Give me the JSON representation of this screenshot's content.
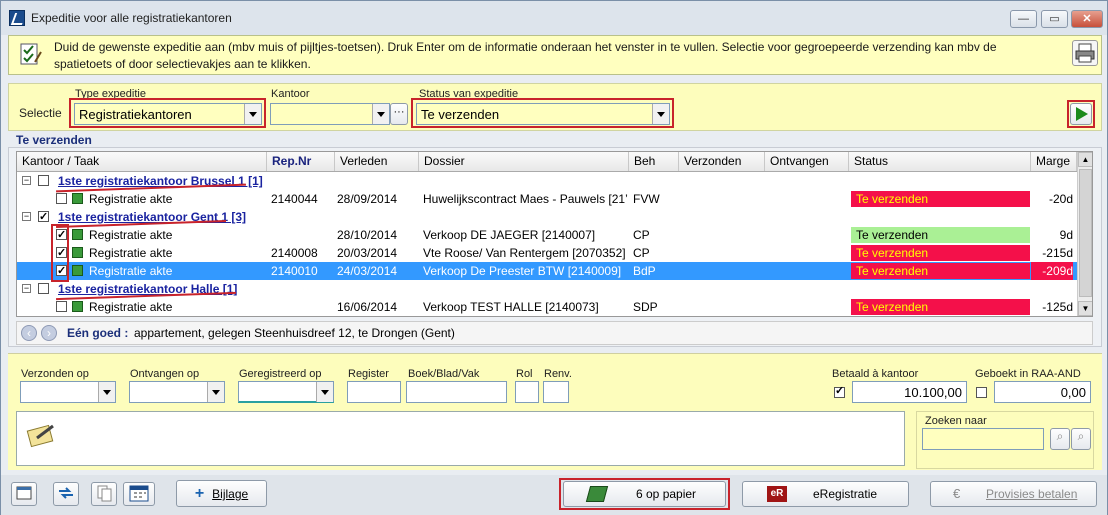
{
  "window": {
    "title": "Expeditie voor alle registratiekantoren"
  },
  "info": {
    "text": "Duid de gewenste expeditie aan (mbv muis of pijltjes-toetsen). Druk Enter om de informatie onderaan het venster in te vullen. Selectie voor gegroepeerde verzending kan mbv de spatietoets of door selectievakjes aan te klikken."
  },
  "selection": {
    "label": "Selectie",
    "type_label": "Type expeditie",
    "type_value": "Registratiekantoren",
    "office_label": "Kantoor",
    "office_value": "",
    "status_label": "Status van expeditie",
    "status_value": "Te verzenden"
  },
  "grid_section": {
    "title": "Te verzenden"
  },
  "columns": [
    "Kantoor / Taak",
    "Rep.Nr",
    "Verleden",
    "Dossier",
    "Beh",
    "Verzonden",
    "Ontvangen",
    "Status",
    "Marge"
  ],
  "rows": [
    {
      "kind": "group",
      "checked": false,
      "name": "1ste registratiekantoor Brussel 1 [1]"
    },
    {
      "kind": "task",
      "checked": false,
      "task": "Registratie akte",
      "rep": "2140044",
      "date": "28/09/2014",
      "dossier": "Huwelijkscontract Maes - Pauwels [21’",
      "beh": "FVW",
      "status": "Te verzenden",
      "status_color": "red",
      "marge": "-20d"
    },
    {
      "kind": "group",
      "checked": true,
      "name": "1ste registratiekantoor Gent 1 [3]"
    },
    {
      "kind": "task",
      "checked": true,
      "task": "Registratie akte",
      "rep": "",
      "date": "28/10/2014",
      "dossier": "Verkoop DE JAEGER [2140007]",
      "beh": "CP",
      "status": "Te verzenden",
      "status_color": "green",
      "marge": "9d"
    },
    {
      "kind": "task",
      "checked": true,
      "task": "Registratie akte",
      "rep": "2140008",
      "date": "20/03/2014",
      "dossier": "Vte Roose/ Van Rentergem [2070352]",
      "beh": "CP",
      "status": "Te verzenden",
      "status_color": "red",
      "marge": "-215d"
    },
    {
      "kind": "task",
      "checked": true,
      "selected": true,
      "task": "Registratie akte",
      "rep": "2140010",
      "date": "24/03/2014",
      "dossier": "Verkoop De Preester BTW [2140009]",
      "beh": "BdP",
      "status": "Te verzenden",
      "status_color": "red",
      "marge": "-209d"
    },
    {
      "kind": "group",
      "checked": false,
      "name": "1ste registratiekantoor Halle [1]"
    },
    {
      "kind": "task",
      "checked": false,
      "task": "Registratie akte",
      "rep": "",
      "date": "16/06/2014",
      "dossier": "Verkoop TEST HALLE [2140073]",
      "beh": "SDP",
      "status": "Te verzenden",
      "status_color": "red",
      "marge": "-125d"
    }
  ],
  "goods": {
    "label": "Eén goed :",
    "text": "appartement, gelegen Steenhuisdreef 12, te Drongen (Gent)"
  },
  "details": {
    "sent_on": "Verzonden op",
    "received_on": "Ontvangen op",
    "registered_on": "Geregistreerd op",
    "register": "Register",
    "book": "Boek/Blad/Vak",
    "rol": "Rol",
    "renv": "Renv.",
    "paid_label": "Betaald à kantoor",
    "paid_value": "10.100,00",
    "paid_checked": true,
    "booked_label": "Geboekt in RAA-AND",
    "booked_value": "0,00",
    "booked_checked": false,
    "search_label": "Zoeken naar",
    "search_value": ""
  },
  "footer": {
    "attachment": "Bijlage",
    "paper": "6 op papier",
    "ereg": "eRegistratie",
    "ereg_badge": "eR",
    "provisions": "Provisies betalen"
  },
  "colors": {
    "accent_red": "#c8232b",
    "status_red": "#f4104a",
    "status_green": "#aaf095",
    "selection": "#3399ff",
    "panel_yellow": "#fdfdbc"
  }
}
